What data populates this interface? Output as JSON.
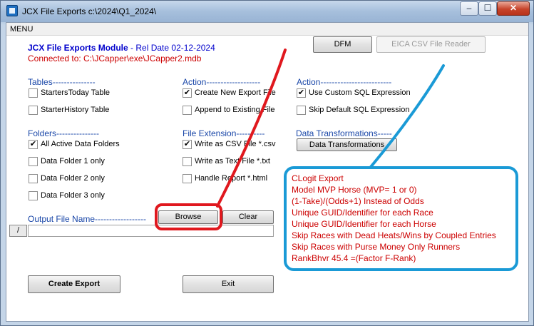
{
  "window": {
    "title": "JCX File Exports c:\\2024\\Q1_2024\\",
    "min_glyph": "–",
    "max_glyph": "☐",
    "close_glyph": "✕"
  },
  "menu": {
    "label": "MENU"
  },
  "header": {
    "module_title": "JCX File Exports Module",
    "rel_date": " - Rel Date 02-12-2024",
    "connected": "Connected to: C:\\JCapper\\exe\\JCapper2.mdb"
  },
  "top_buttons": {
    "dfm": "DFM",
    "eica": "EICA CSV File Reader"
  },
  "tables": {
    "heading": "Tables---------------",
    "items": [
      {
        "label": "StartersToday Table",
        "checked": false
      },
      {
        "label": "StarterHistory Table",
        "checked": false
      }
    ]
  },
  "action1": {
    "heading": "Action-------------------",
    "items": [
      {
        "label": "Create New Export File",
        "checked": true
      },
      {
        "label": "Append to Existing File",
        "checked": false
      }
    ]
  },
  "action2": {
    "heading": "Action-------------------------",
    "items": [
      {
        "label": "Use Custom SQL Expression",
        "checked": true
      },
      {
        "label": "Skip Default SQL Expression",
        "checked": false
      }
    ]
  },
  "folders": {
    "heading": "Folders---------------",
    "items": [
      {
        "label": "All Active Data Folders",
        "checked": true
      },
      {
        "label": "Data Folder 1 only",
        "checked": false
      },
      {
        "label": "Data Folder 2 only",
        "checked": false
      },
      {
        "label": "Data Folder 3 only",
        "checked": false
      }
    ]
  },
  "file_ext": {
    "heading": "File Extension----------",
    "items": [
      {
        "label": "Write as CSV File  *.csv",
        "checked": true
      },
      {
        "label": "Write as Text File *.txt",
        "checked": false
      },
      {
        "label": "Handle Report *.html",
        "checked": false
      }
    ]
  },
  "data_transform": {
    "heading": "Data Transformations-----",
    "button": "Data Transformations"
  },
  "output": {
    "heading": "Output File Name------------------",
    "browse": "Browse",
    "clear": "Clear",
    "slash": "/",
    "value": ""
  },
  "info": {
    "lines": [
      "CLogit Export",
      "Model MVP Horse (MVP= 1 or 0)",
      "(1-Take)/(Odds+1) Instead of Odds",
      "Unique GUID/Identifier for each Race",
      "Unique GUID/Identifier for each Horse",
      "Skip Races with Dead Heats/Wins by Coupled Entries",
      "Skip Races with Purse Money Only Runners",
      "RankBhvr 45.4 =(Factor F-Rank)"
    ]
  },
  "bottom": {
    "create": "Create Export",
    "exit": "Exit"
  },
  "colors": {
    "annotation_red": "#e0181e",
    "annotation_blue": "#1a9ad6"
  }
}
